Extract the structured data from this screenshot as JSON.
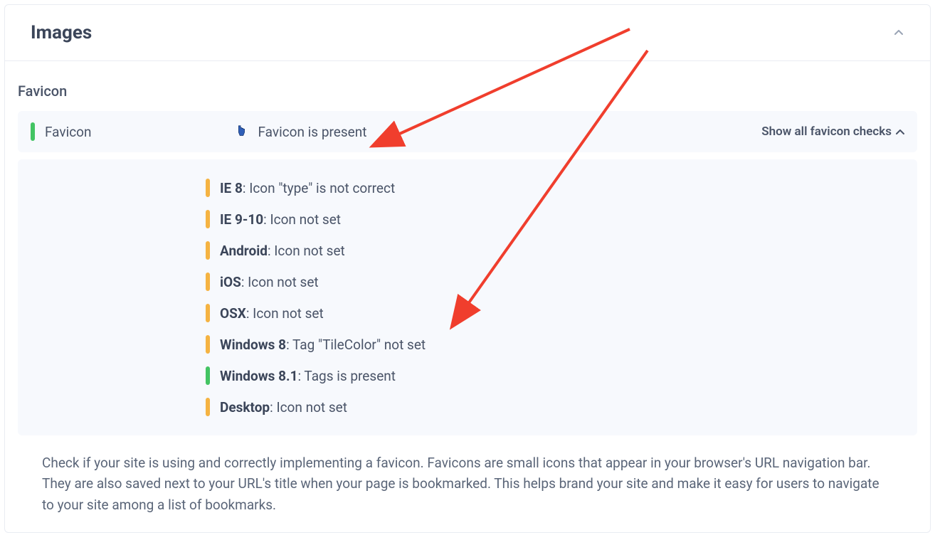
{
  "header": {
    "title": "Images"
  },
  "section": {
    "title": "Favicon",
    "summary": {
      "label": "Favicon",
      "status_text": "Favicon is present",
      "status_color": "green",
      "expand_label": "Show all favicon checks"
    },
    "checks": [
      {
        "platform": "IE 8",
        "message": ": Icon \"type\" is not correct",
        "status": "orange"
      },
      {
        "platform": "IE 9-10",
        "message": ": Icon not set",
        "status": "orange"
      },
      {
        "platform": "Android",
        "message": ": Icon not set",
        "status": "orange"
      },
      {
        "platform": "iOS",
        "message": ": Icon not set",
        "status": "orange"
      },
      {
        "platform": "OSX",
        "message": ": Icon not set",
        "status": "orange"
      },
      {
        "platform": "Windows 8",
        "message": ": Tag \"TileColor\" not set",
        "status": "orange"
      },
      {
        "platform": "Windows 8.1",
        "message": ": Tags is present",
        "status": "green"
      },
      {
        "platform": "Desktop",
        "message": ": Icon not set",
        "status": "orange"
      }
    ],
    "description_line1": "Check if your site is using and correctly implementing a favicon. Favicons are small icons that appear in your browser's URL navigation bar.",
    "description_line2": "They are also saved next to your URL's title when your page is bookmarked. This helps brand your site and make it easy for users to navigate to your site among a list of bookmarks."
  },
  "colors": {
    "green": "#43c463",
    "orange": "#f5b342",
    "arrow": "#f03e2d"
  }
}
